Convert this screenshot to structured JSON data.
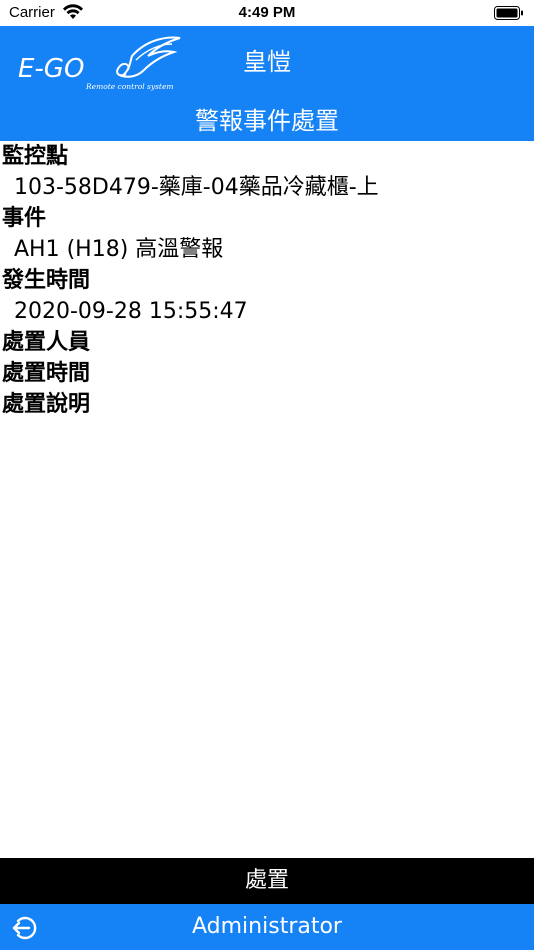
{
  "status_bar": {
    "carrier": "Carrier",
    "time": "4:49 PM"
  },
  "header": {
    "logo_text": "E-GO",
    "logo_tagline": "Remote control system",
    "title": "皇愷",
    "subtitle": "警報事件處置"
  },
  "fields": {
    "monitor_point_label": "監控點",
    "monitor_point_value": "103-58D479-藥庫-04藥品冷藏櫃-上",
    "event_label": "事件",
    "event_value": "AH1 (H18) 高溫警報",
    "occurred_time_label": "發生時間",
    "occurred_time_value": "2020-09-28 15:55:47",
    "handler_label": "處置人員",
    "handle_time_label": "處置時間",
    "handle_note_label": "處置說明"
  },
  "actions": {
    "handle_button": "處置"
  },
  "footer": {
    "user": "Administrator"
  },
  "colors": {
    "primary": "#1582f5",
    "action_bar": "#000000",
    "text_on_primary": "#ffffff"
  },
  "icons": {
    "wifi": "wifi-icon",
    "battery": "battery-icon",
    "logout": "logout-icon"
  }
}
